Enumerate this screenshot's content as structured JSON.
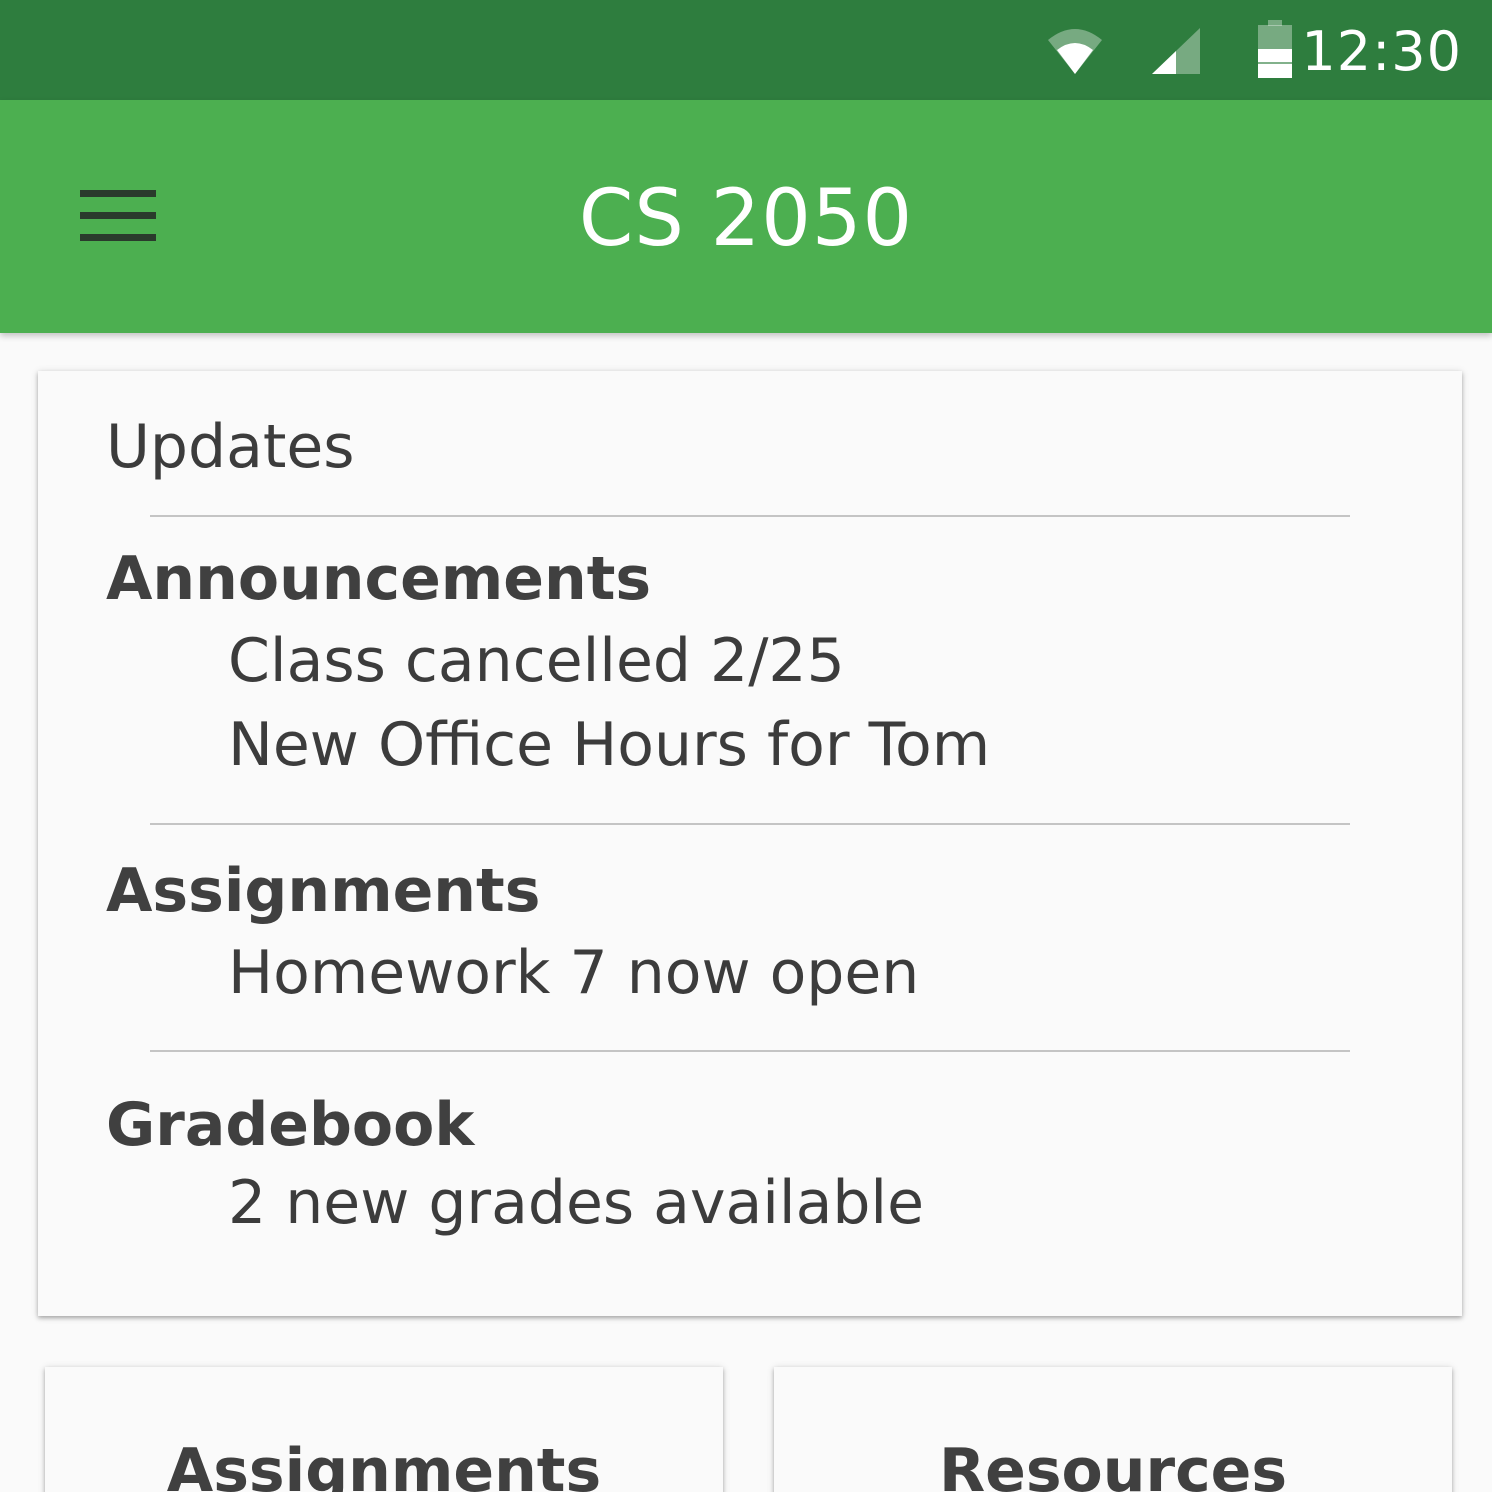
{
  "status_bar": {
    "time": "12:30",
    "icons": [
      "wifi-icon",
      "cellular-signal-icon",
      "battery-icon"
    ],
    "color": "#2e7d3e"
  },
  "app_bar": {
    "title": "CS 2050",
    "menu_icon": "hamburger-menu-icon",
    "color": "#4caf50"
  },
  "updates": {
    "heading": "Updates",
    "sections": [
      {
        "title": "Announcements",
        "items": [
          "Class cancelled 2/25",
          "New Office Hours for Tom"
        ]
      },
      {
        "title": "Assignments",
        "items": [
          "Homework 7 now open"
        ]
      },
      {
        "title": "Gradebook",
        "items": [
          "2 new grades available"
        ]
      }
    ]
  },
  "tiles": [
    {
      "label": "Assignments"
    },
    {
      "label": "Resources"
    }
  ]
}
